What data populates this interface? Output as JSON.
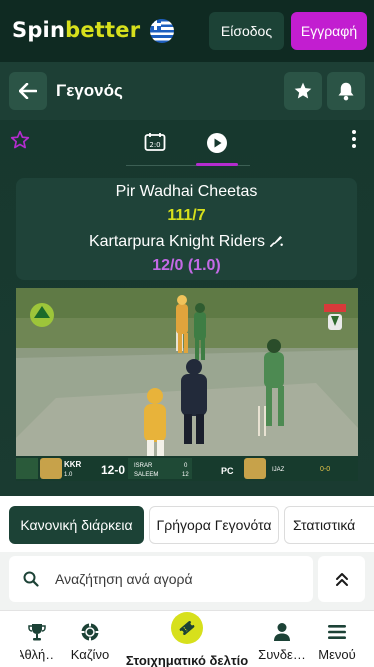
{
  "header": {
    "logo_spin": "Spin",
    "logo_better": "better",
    "login_label": "Είσοδος",
    "register_label": "Εγγραφή"
  },
  "event_bar": {
    "title": "Γεγονός"
  },
  "match": {
    "team1": "Pir Wadhai Cheetas",
    "score1": "111/7",
    "team2": "Kartarpura Knight Riders",
    "score2": "12/0 (1.0)",
    "colors": {
      "score1": "#d7e01c",
      "score2": "#c46ae6",
      "active_tab": "#b42ccf"
    }
  },
  "video_overlay": {
    "team_left": "KKR",
    "overs": "1.0",
    "score": "12-0",
    "batter1": "ISRAR",
    "batter1_score": "0",
    "batter2": "SALEEM",
    "batter2_score": "12",
    "bowling_team": "PC",
    "bowler": "IJAZ",
    "bowler_figures": "0-0"
  },
  "market_tabs": [
    {
      "label": "Κανονική διάρκεια",
      "active": true
    },
    {
      "label": "Γρήγορα Γεγονότα",
      "active": false
    },
    {
      "label": "Στατιστικά",
      "active": false
    }
  ],
  "search": {
    "placeholder": "Αναζήτηση ανά αγορά"
  },
  "bottom_nav": {
    "sports": "Αθλή…",
    "casino": "Καζίνο",
    "betslip": "Στοιχηματικό δελτίο",
    "login": "Συνδε…",
    "menu": "Μενού"
  }
}
